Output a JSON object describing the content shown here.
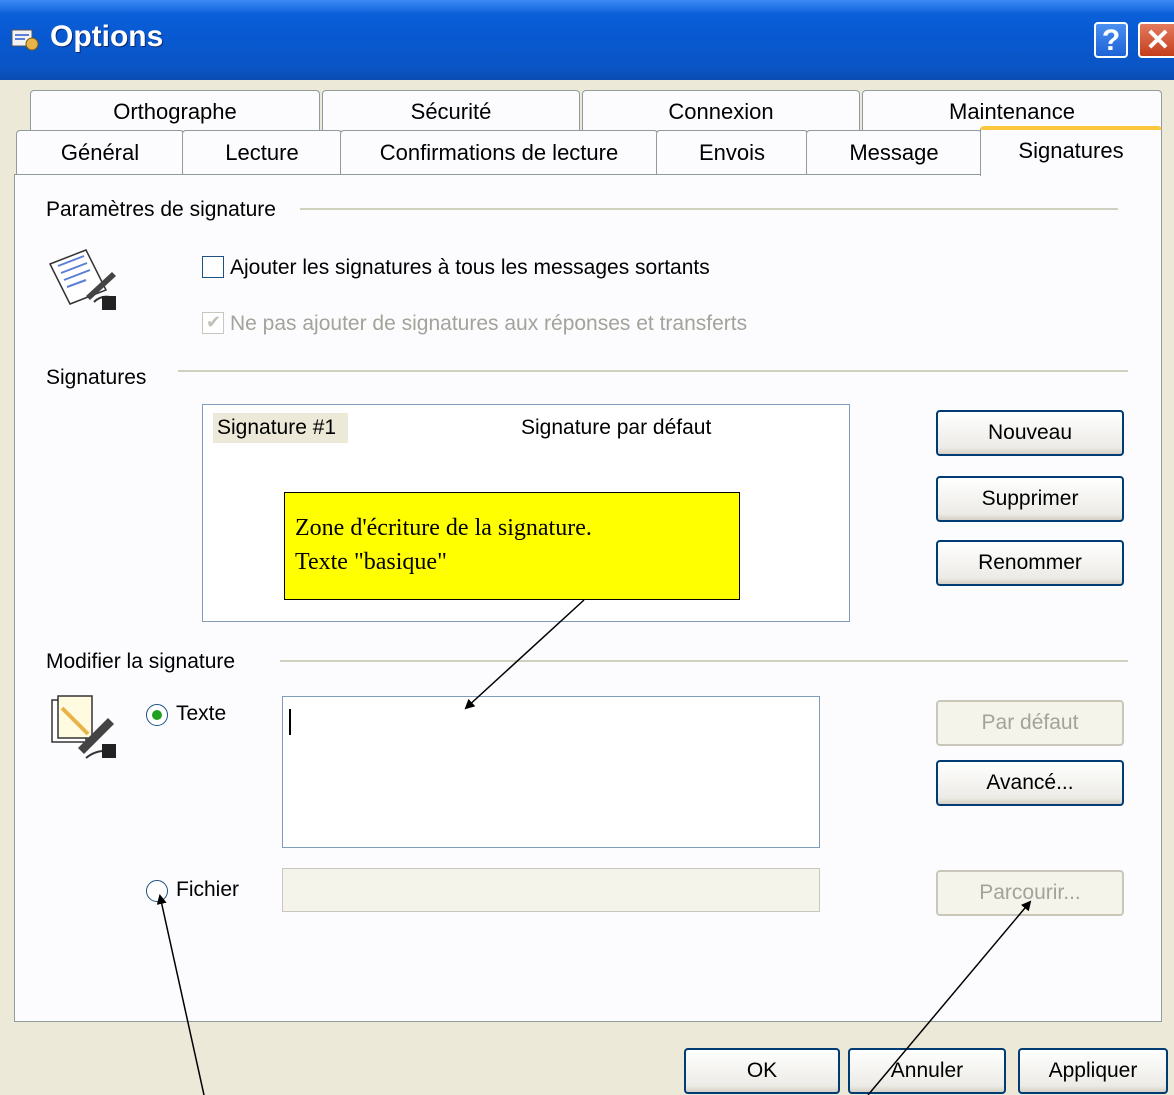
{
  "window": {
    "title": "Options",
    "help_icon": "help-icon",
    "close_icon": "close-icon"
  },
  "tabs": {
    "row1": [
      "Orthographe",
      "Sécurité",
      "Connexion",
      "Maintenance"
    ],
    "row2": [
      "Général",
      "Lecture",
      "Confirmations de lecture",
      "Envois",
      "Message",
      "Signatures"
    ],
    "active": "Signatures"
  },
  "settings": {
    "group_label": "Paramètres de signature",
    "icon": "signature-document-icon",
    "add_signatures": {
      "label": "Ajouter les signatures à tous les messages sortants",
      "checked": false
    },
    "no_replies": {
      "label": "Ne pas ajouter de signatures aux réponses et transferts",
      "checked": true,
      "disabled": true
    }
  },
  "signatures": {
    "group_label": "Signatures",
    "list": [
      {
        "name": "Signature #1",
        "note": "Signature par défaut",
        "selected": true
      }
    ],
    "buttons": {
      "new": "Nouveau",
      "delete": "Supprimer",
      "rename": "Renommer"
    }
  },
  "edit": {
    "group_label": "Modifier la signature",
    "icon": "edit-signature-icon",
    "text_option": {
      "label": "Texte",
      "selected": true
    },
    "file_option": {
      "label": "Fichier",
      "selected": false
    },
    "text_value": "",
    "file_value": "",
    "buttons": {
      "default": "Par défaut",
      "advanced": "Avancé...",
      "browse": "Parcourir..."
    }
  },
  "footer": {
    "ok": "OK",
    "cancel": "Annuler",
    "apply": "Appliquer"
  },
  "annotation": {
    "line1": "Zone d'écriture de la signature.",
    "line2": "Texte \"basique\""
  },
  "colors": {
    "titlebar": "#0a5fd8",
    "active_tab_accent": "#ffc83c",
    "callout": "#ffff00",
    "radio_dot": "#21a121"
  }
}
